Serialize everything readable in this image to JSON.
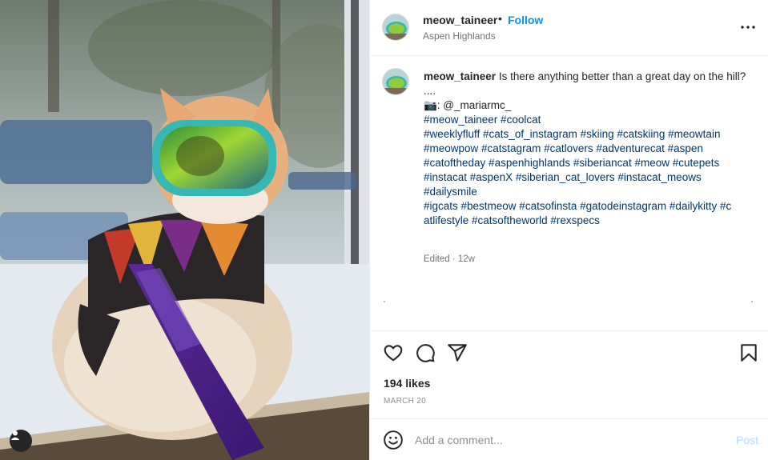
{
  "post": {
    "username": "meow_taineer",
    "separator": "•",
    "follow_label": "Follow",
    "location": "Aspen Highlands",
    "caption_lines": [
      "Is there anything better than a great day on the hill?",
      "....",
      "📷: @_mariarmc_"
    ],
    "caption_credit_handle": "@_mariarmc_",
    "hashtag_lines": [
      "#meow_taineer #coolcat",
      "#weeklyfluff  #cats_of_instagram #skiing #catskiing #meowtain",
      "#meowpow #catstagram #catlovers #adventurecat #aspen",
      "#catoftheday #aspenhighlands #siberiancat #meow #cutepets",
      "#instacat #aspenX #siberian_cat_lovers #instacat_meows",
      "#dailysmile",
      "#igcats #bestmeow #catsofinsta #gatodeinstagram #dailykitty #c",
      "atlifestyle #catsoftheworld #rexspecs"
    ],
    "edited": "Edited · 12w",
    "likes": "194 likes",
    "date": "MARCH 20"
  },
  "comment": {
    "placeholder": "Add a comment...",
    "post_label": "Post"
  },
  "icons": {
    "more": "more-options-icon",
    "like": "heart-icon",
    "comment": "comment-icon",
    "share": "send-icon",
    "save": "bookmark-icon",
    "emoji": "emoji-icon",
    "tag_user": "user-icon"
  },
  "colors": {
    "accent": "#0095f6",
    "link": "#00376b",
    "muted": "#737373",
    "post_disabled": "#b3dbff"
  }
}
